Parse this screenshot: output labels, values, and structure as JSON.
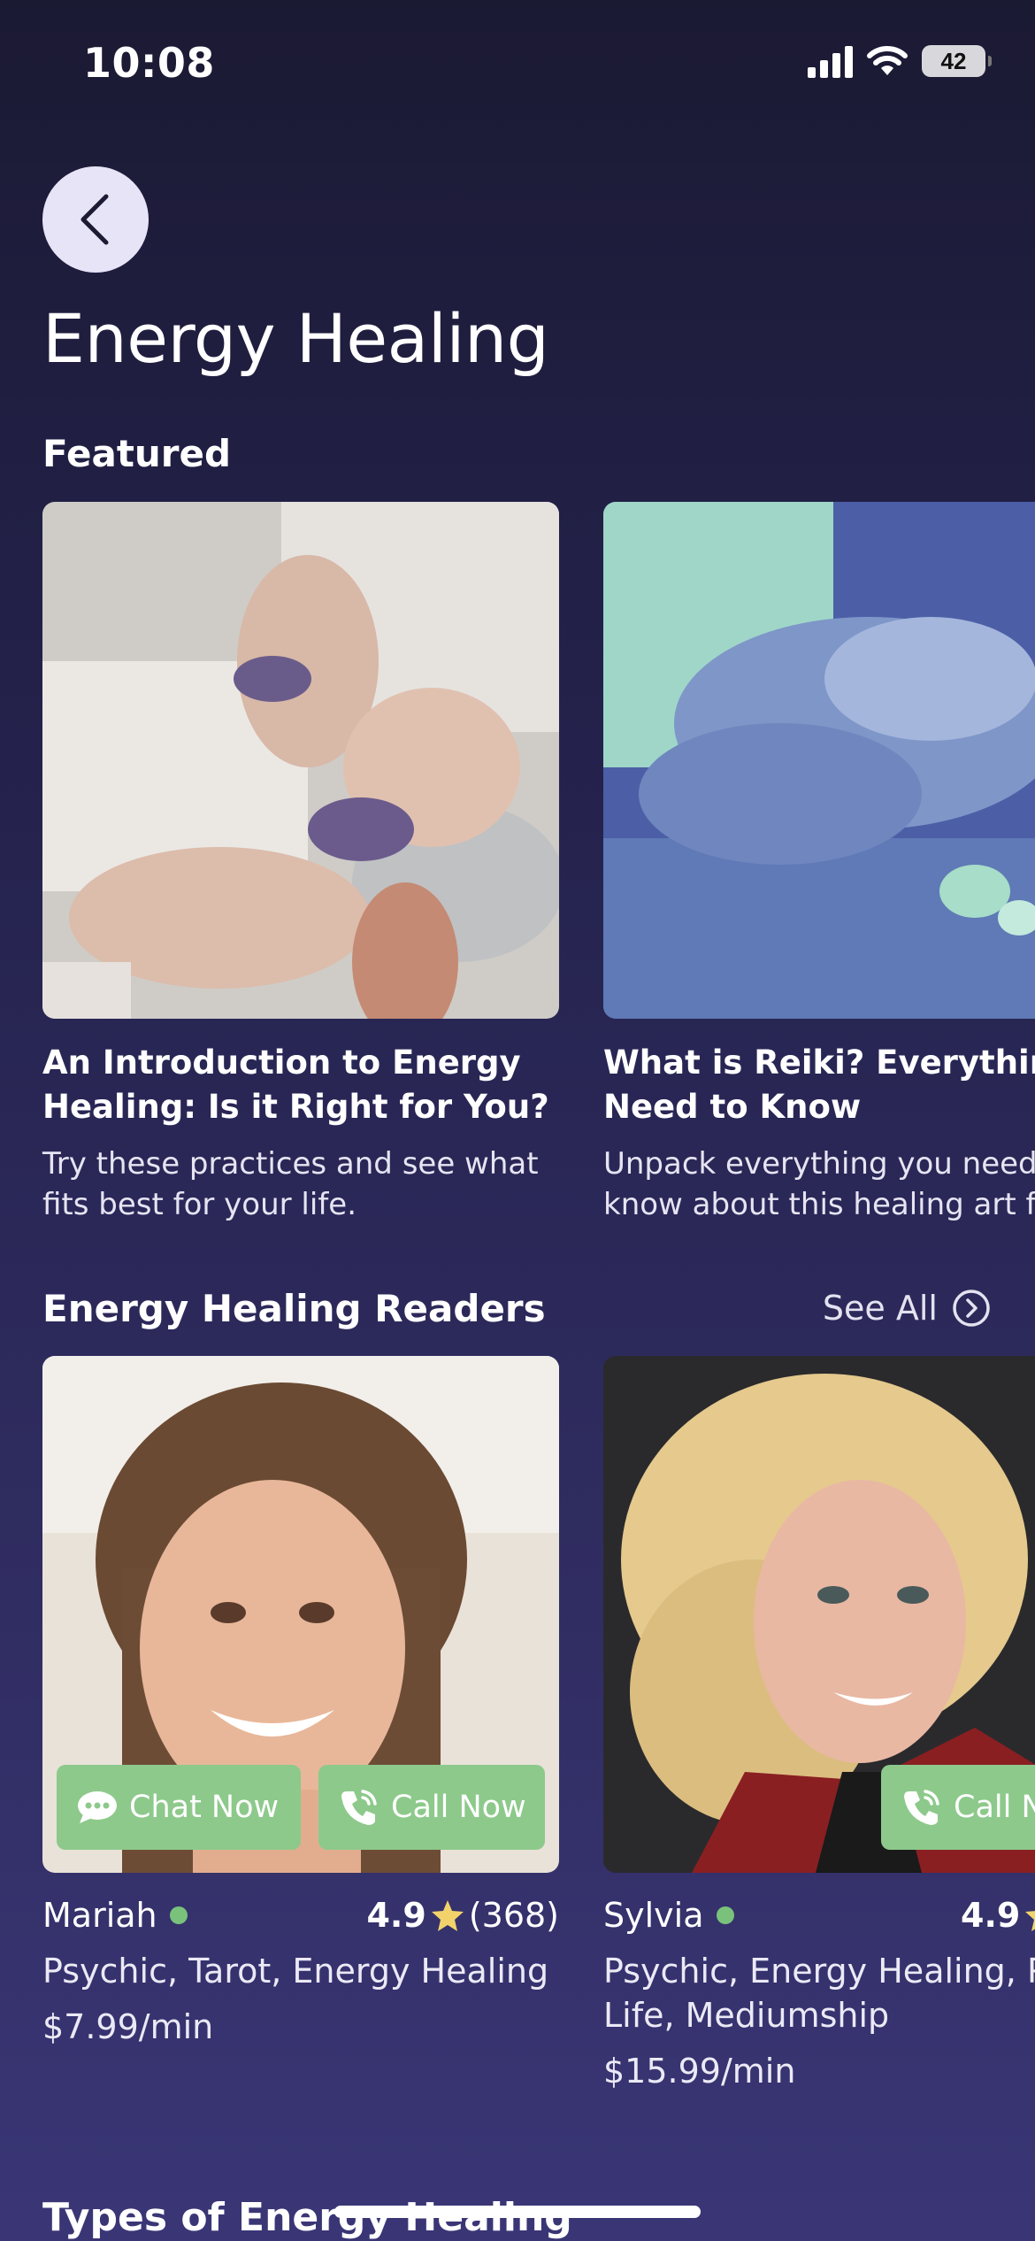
{
  "status_bar": {
    "time": "10:08",
    "battery": "42"
  },
  "header": {
    "title": "Energy Healing"
  },
  "featured": {
    "title": "Featured",
    "articles": [
      {
        "title_line1": "An Introduction to Energy",
        "title_line2": "Healing: Is it Right for You?",
        "desc_line1": "Try these practices and see what",
        "desc_line2": "fits best for your life."
      },
      {
        "title_line1": "What is Reiki? Everything Y",
        "title_line2": "Need to Know",
        "desc_line1": "Unpack everything you need t",
        "desc_line2": "know about this healing art fo"
      }
    ]
  },
  "readers": {
    "title": "Energy Healing Readers",
    "see_all": "See All",
    "items": [
      {
        "name": "Mariah",
        "rating": "4.9",
        "reviews": "(368)",
        "skills_line1": "Psychic, Tarot, Energy Healing",
        "skills_line2": "",
        "price": "$7.99/min",
        "chat_label": "Chat Now",
        "call_label": "Call Now"
      },
      {
        "name": "Sylvia",
        "rating": "4.9",
        "reviews": "",
        "skills_line1": "Psychic, Energy Healing, Pas",
        "skills_line2": "Life, Mediumship",
        "price": "$15.99/min",
        "call_label": "Call N"
      }
    ]
  },
  "types": {
    "title": "Types of Energy Healing"
  },
  "colors": {
    "accent_green": "#8dc98b",
    "online": "#7ac27b",
    "star": "#f2d36b",
    "background_top": "#1b1a33",
    "background_bottom": "#3a3676"
  }
}
